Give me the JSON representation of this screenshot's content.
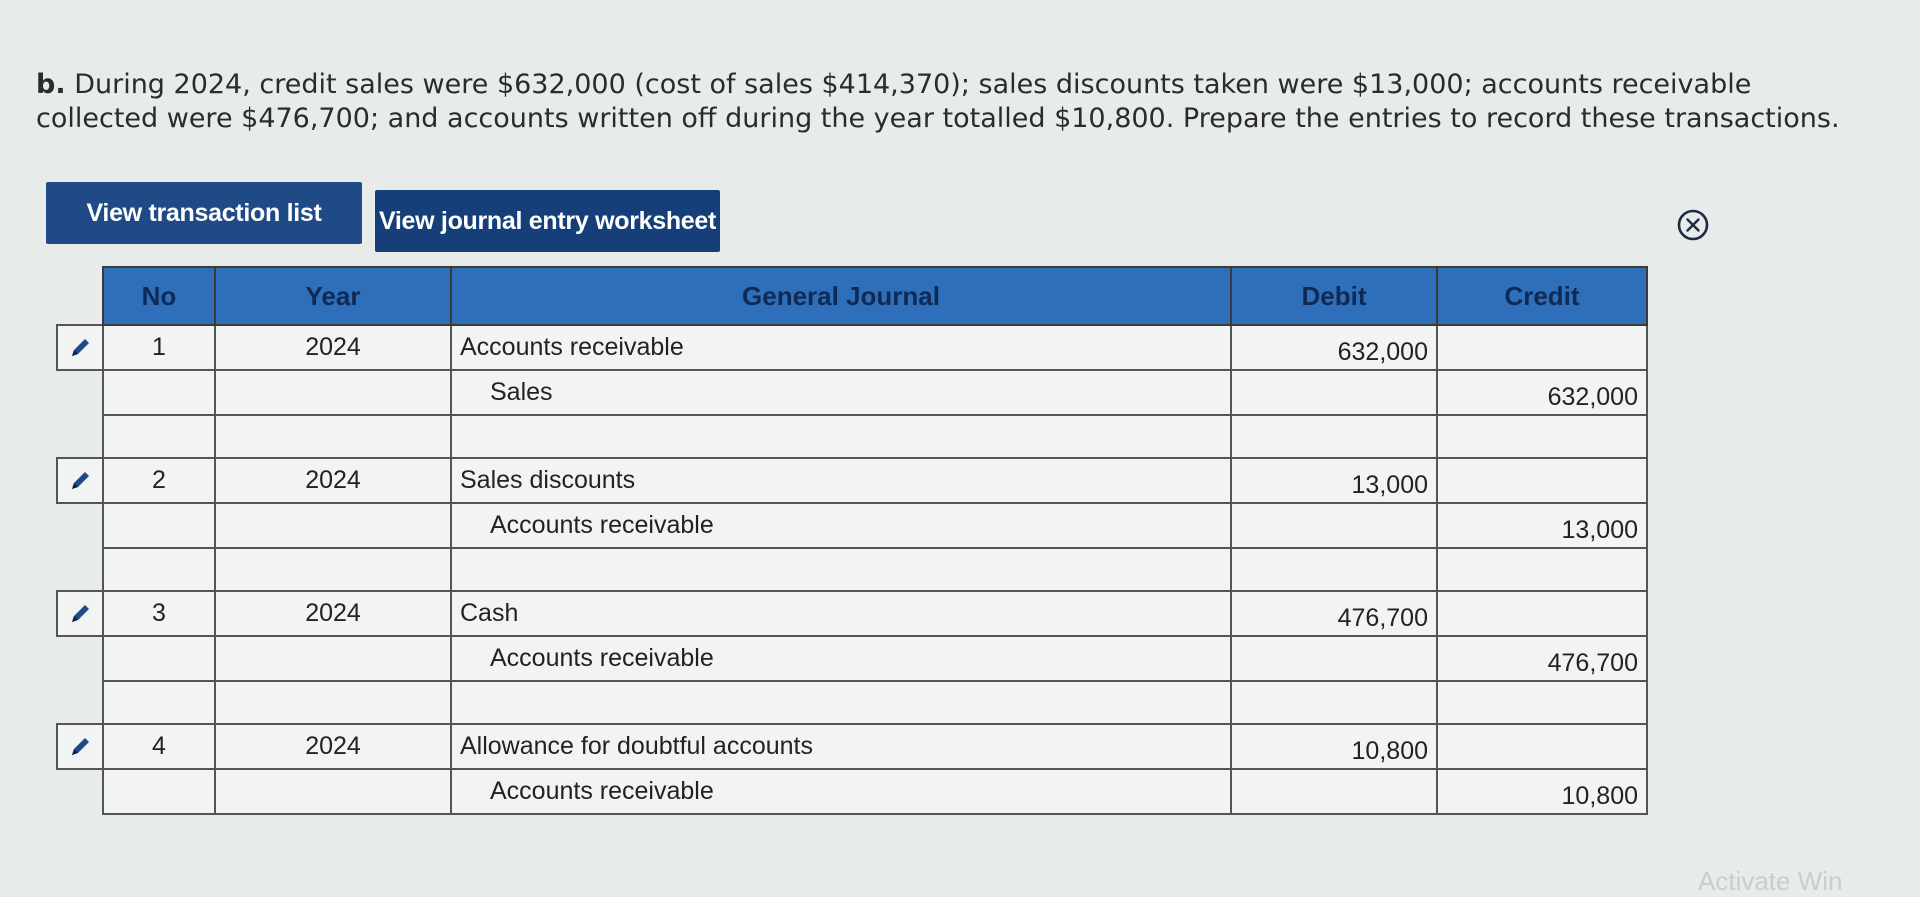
{
  "question": {
    "label": "b.",
    "text": "During 2024, credit sales were $632,000 (cost of sales $414,370); sales discounts taken were $13,000; accounts receivable collected were $476,700; and accounts written off during the year totalled $10,800. Prepare the entries to record these transactions."
  },
  "buttons": {
    "transaction_list": "View transaction list",
    "journal_worksheet": "View journal entry worksheet"
  },
  "icons": {
    "close": "close-icon",
    "edit": "pencil-icon"
  },
  "table": {
    "headers": {
      "no": "No",
      "year": "Year",
      "journal": "General Journal",
      "debit": "Debit",
      "credit": "Credit"
    },
    "entries": [
      {
        "no": "1",
        "year": "2024",
        "debit_account": "Accounts receivable",
        "debit_amount": "632,000",
        "credit_account": "Sales",
        "credit_amount": "632,000"
      },
      {
        "no": "2",
        "year": "2024",
        "debit_account": "Sales discounts",
        "debit_amount": "13,000",
        "credit_account": "Accounts receivable",
        "credit_amount": "13,000"
      },
      {
        "no": "3",
        "year": "2024",
        "debit_account": "Cash",
        "debit_amount": "476,700",
        "credit_account": "Accounts receivable",
        "credit_amount": "476,700"
      },
      {
        "no": "4",
        "year": "2024",
        "debit_account": "Allowance for doubtful accounts",
        "debit_amount": "10,800",
        "credit_account": "Accounts receivable",
        "credit_amount": "10,800"
      }
    ]
  },
  "colors": {
    "button_bg": "#1f4a86",
    "header_bg": "#2f6fb9",
    "header_text": "#102a56"
  },
  "watermark": "Activate Win"
}
